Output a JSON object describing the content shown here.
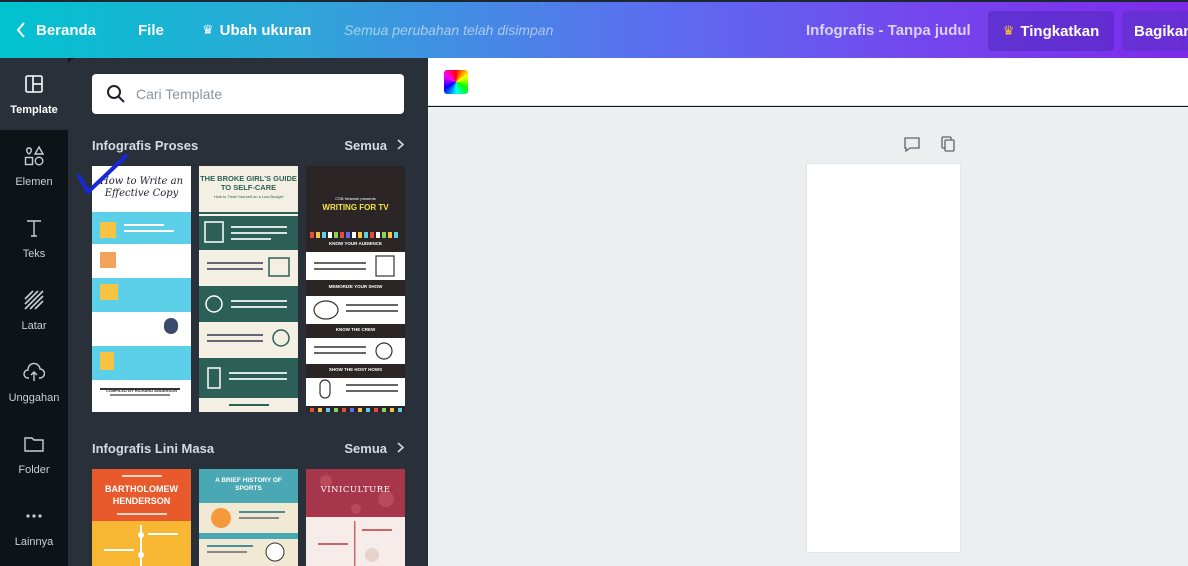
{
  "topbar": {
    "home_label": "Beranda",
    "file_label": "File",
    "resize_label": "Ubah ukuran",
    "saved_status": "Semua perubahan telah disimpan",
    "doc_title": "Infografis - Tanpa judul",
    "upgrade_label": "Tingkatkan",
    "share_label": "Bagikan"
  },
  "rail": {
    "items": [
      {
        "label": "Template",
        "icon": "template-icon"
      },
      {
        "label": "Elemen",
        "icon": "elements-icon"
      },
      {
        "label": "Teks",
        "icon": "text-icon"
      },
      {
        "label": "Latar",
        "icon": "background-icon"
      },
      {
        "label": "Unggahan",
        "icon": "upload-icon"
      },
      {
        "label": "Folder",
        "icon": "folder-icon"
      },
      {
        "label": "Lainnya",
        "icon": "more-icon"
      }
    ]
  },
  "panel": {
    "search_placeholder": "Cari Template",
    "sections": [
      {
        "title": "Infografis Proses",
        "all_label": "Semua",
        "templates": [
          {
            "title": "How to Write an Effective Copy",
            "footer": "COMPILED BY RICHARD ANDERSON"
          },
          {
            "title": "THE BROKE GIRL'S GUIDE TO SELF-CARE",
            "subtitle": "How to Treat Yourself on a Low Budget"
          },
          {
            "title": "WRITING FOR TV",
            "kicker": "CSB Network presents",
            "headings": [
              "KNOW YOUR AUDIENCE",
              "MEMORIZE YOUR SHOW",
              "KNOW THE CREW",
              "SHOW THE HOST HOWS"
            ]
          }
        ]
      },
      {
        "title": "Infografis Lini Masa",
        "all_label": "Semua",
        "templates": [
          {
            "title": "BARTHOLOMEW HENDERSON"
          },
          {
            "title": "A BRIEF HISTORY OF SPORTS"
          },
          {
            "title": "VINICULTURE"
          }
        ]
      }
    ]
  },
  "colors": {
    "gradient_start": "#00c3cf",
    "gradient_end": "#7d2ae8",
    "crown": "#ffc82c",
    "panel_bg": "#293039",
    "rail_bg": "#0e1318"
  }
}
